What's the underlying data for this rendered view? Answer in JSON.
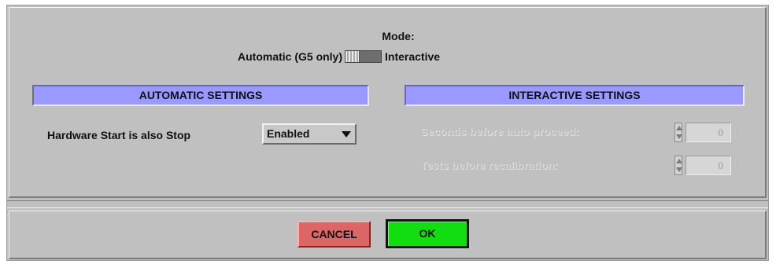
{
  "mode": {
    "label": "Mode:",
    "left_option": "Automatic (G5 only)",
    "right_option": "Interactive",
    "selected": "Automatic (G5 only)"
  },
  "automatic_settings": {
    "header": "AUTOMATIC SETTINGS",
    "hardware_start_label": "Hardware Start is also Stop",
    "hardware_start_value": "Enabled"
  },
  "interactive_settings": {
    "header": "INTERACTIVE SETTINGS",
    "seconds_label": "Seconds before auto proceed:",
    "seconds_value": "0",
    "tests_label": "Tests before recalibration:",
    "tests_value": "0",
    "enabled": false
  },
  "buttons": {
    "cancel": "CANCEL",
    "ok": "OK"
  },
  "colors": {
    "panel_bg": "#c0c0c0",
    "section_header": "#9999ff",
    "cancel": "#dc6666",
    "ok": "#11dd11"
  }
}
